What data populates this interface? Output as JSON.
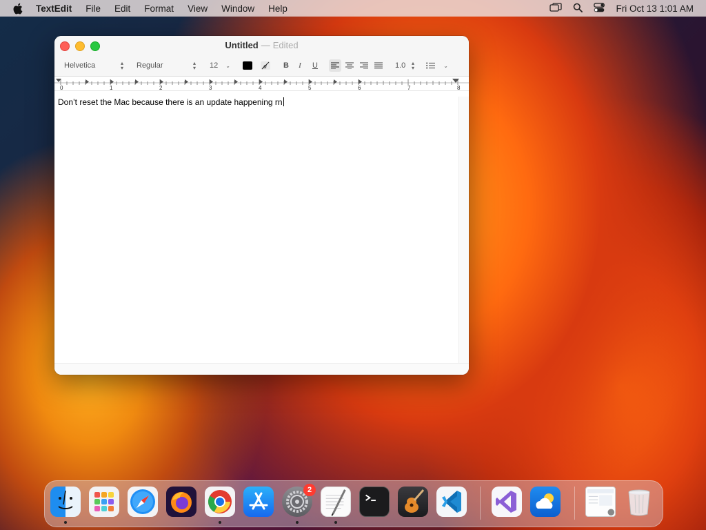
{
  "menubar": {
    "app_name": "TextEdit",
    "items": [
      "File",
      "Edit",
      "Format",
      "View",
      "Window",
      "Help"
    ],
    "clock": "Fri Oct 13  1:01 AM",
    "icons": [
      "apple-icon",
      "screen-mirroring-icon",
      "spotlight-search-icon",
      "control-center-icon"
    ]
  },
  "window": {
    "title": "Untitled",
    "separator": "—",
    "edited_label": "Edited",
    "toolbar": {
      "font_family": "Helvetica",
      "font_style": "Regular",
      "font_size": "12",
      "text_color": "#000000",
      "bold": "B",
      "italic": "I",
      "underline": "U",
      "line_spacing": "1.0"
    },
    "ruler_labels": [
      "0",
      "1",
      "2",
      "3",
      "4",
      "5",
      "6",
      "7",
      "8"
    ],
    "document_text": "Don’t reset the Mac because there is an update happening rn"
  },
  "dock": {
    "apps": [
      "Finder",
      "Launchpad",
      "Safari",
      "Firefox",
      "Google Chrome",
      "App Store",
      "System Settings",
      "TextEdit",
      "Terminal",
      "GarageBand",
      "Visual Studio Code",
      "Visual Studio",
      "Weather",
      "Downloads",
      "Trash"
    ],
    "running": [
      "Finder",
      "Google Chrome",
      "System Settings",
      "TextEdit"
    ],
    "system_settings_badge": "2"
  },
  "colors": {
    "close": "#fe5f57",
    "minimize": "#febc2e",
    "zoom": "#28c840",
    "badge": "#ff3b30"
  }
}
